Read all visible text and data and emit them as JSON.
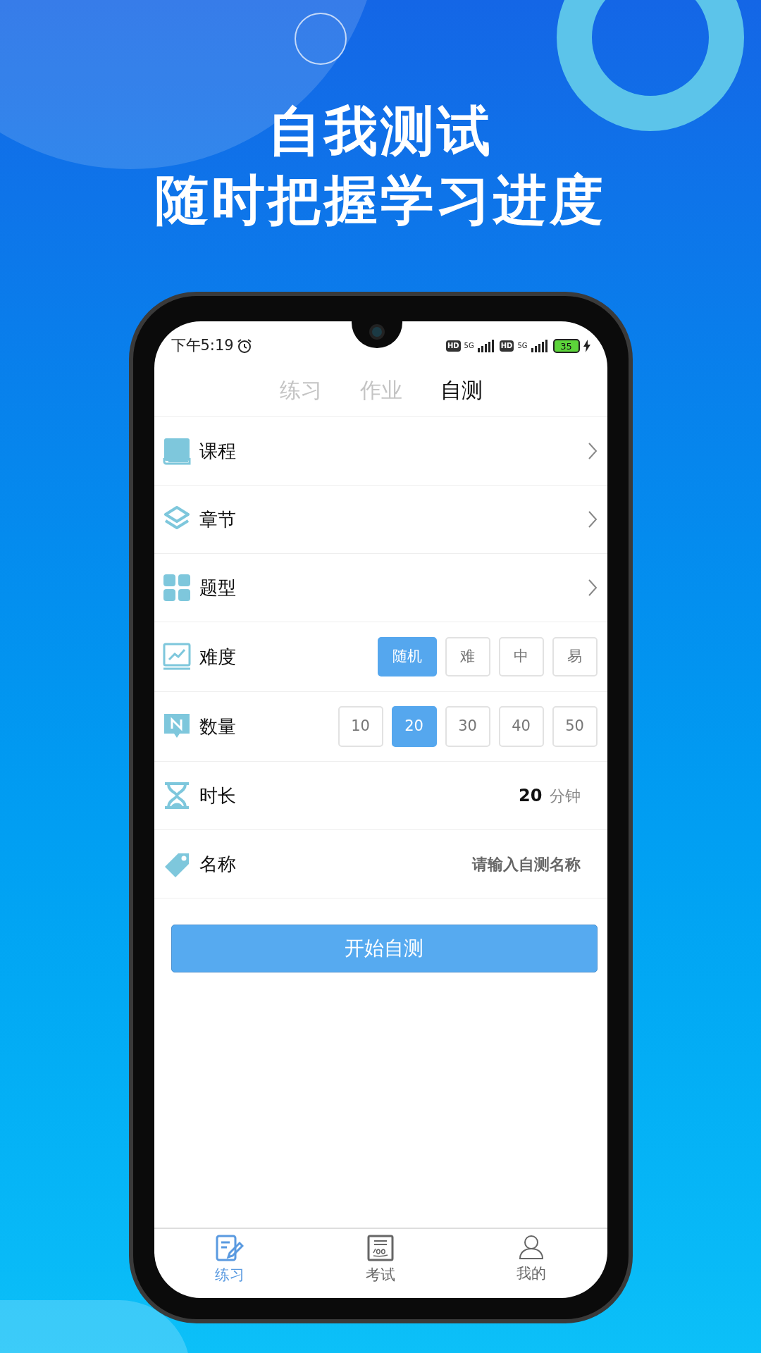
{
  "headline": [
    "自我测试",
    "随时把握学习进度"
  ],
  "status_bar": {
    "time": "下午5:19",
    "hd_1": "HD",
    "network_1": "5G",
    "hd_2": "HD",
    "network_2": "5G",
    "battery": "35"
  },
  "tabs": [
    {
      "label": "练习",
      "selected": false
    },
    {
      "label": "作业",
      "selected": false
    },
    {
      "label": "自测",
      "selected": true
    }
  ],
  "rows": [
    {
      "kind": "link",
      "label": "课程"
    },
    {
      "kind": "link",
      "label": "章节"
    },
    {
      "kind": "link",
      "label": "题型"
    },
    {
      "kind": "options",
      "label": "难度",
      "options": [
        {
          "label": "随机",
          "selected": true
        },
        {
          "label": "难",
          "selected": false
        },
        {
          "label": "中",
          "selected": false
        },
        {
          "label": "易",
          "selected": false
        }
      ]
    },
    {
      "kind": "options",
      "label": "数量",
      "options": [
        {
          "label": "10",
          "selected": false
        },
        {
          "label": "20",
          "selected": true
        },
        {
          "label": "30",
          "selected": false
        },
        {
          "label": "40",
          "selected": false
        },
        {
          "label": "50",
          "selected": false
        }
      ]
    },
    {
      "kind": "value",
      "label": "时长",
      "value": "20",
      "unit": "分钟"
    },
    {
      "kind": "input",
      "label": "名称",
      "placeholder": "请输入自测名称"
    }
  ],
  "start_button": "开始自测",
  "bottom_nav": [
    {
      "label": "练习",
      "selected": true
    },
    {
      "label": "考试",
      "selected": false
    },
    {
      "label": "我的",
      "selected": false
    }
  ]
}
